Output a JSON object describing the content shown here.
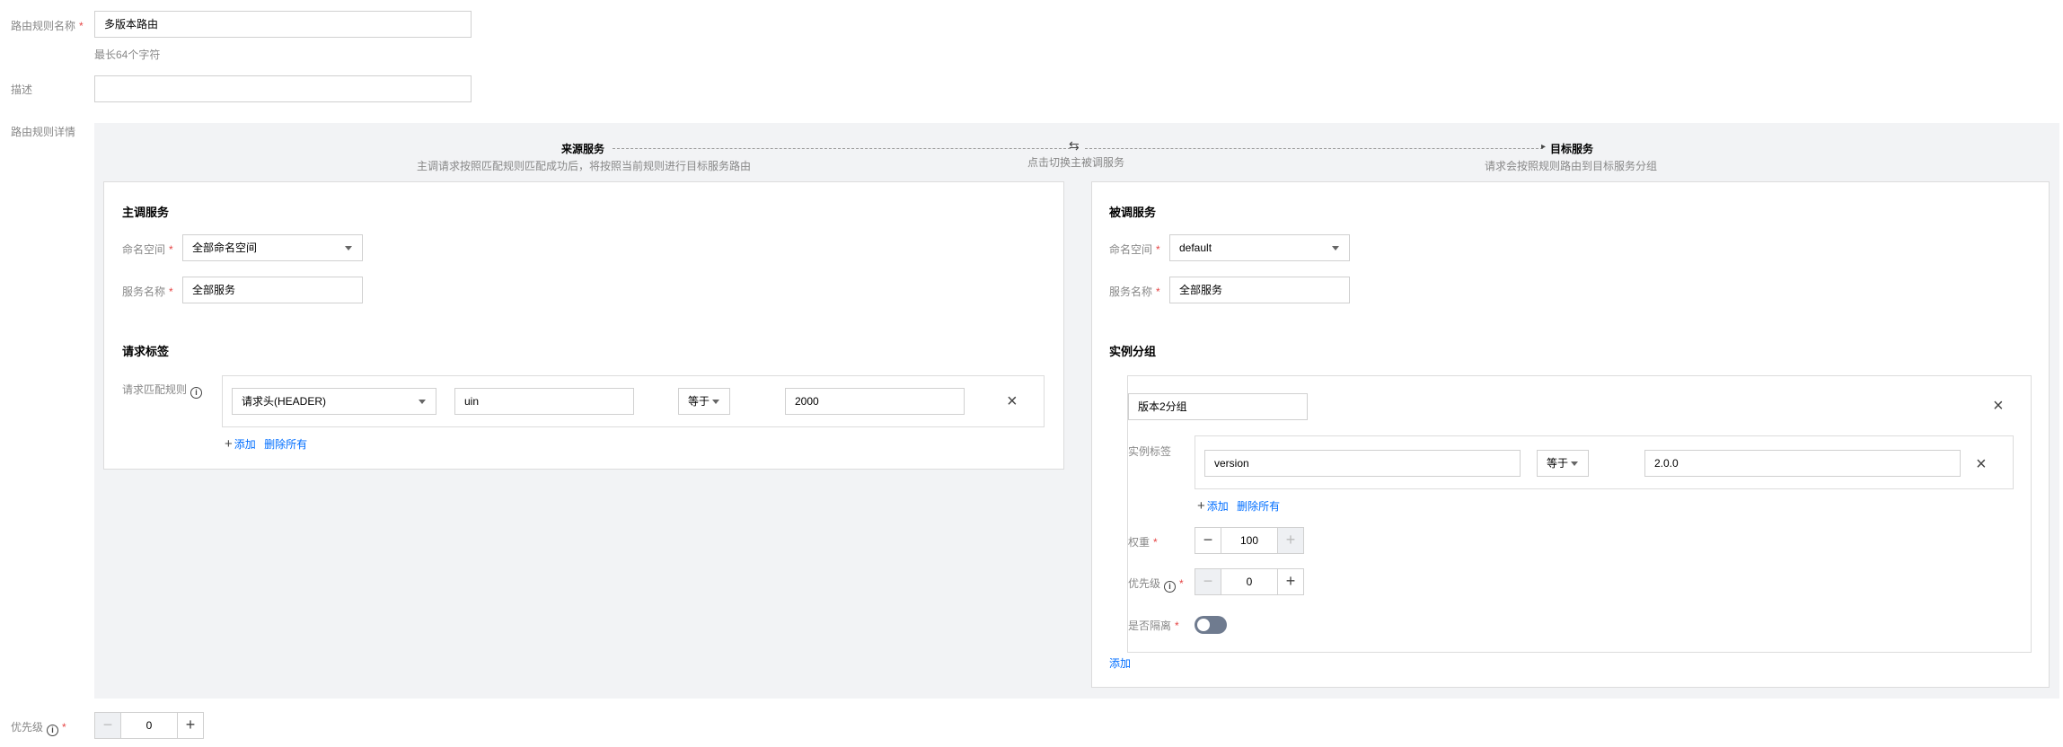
{
  "form": {
    "name_label": "路由规则名称",
    "required_mark": "*",
    "name_value": "多版本路由",
    "name_hint": "最长64个字符",
    "desc_label": "描述",
    "desc_value": "",
    "detail_label": "路由规则详情",
    "priority_label": "优先级",
    "priority_value": "0"
  },
  "flow": {
    "source_title": "来源服务",
    "source_desc": "主调请求按照匹配规则匹配成功后，将按照当前规则进行目标服务路由",
    "switch_symbol": "⇆",
    "switch_text": "点击切换主被调服务",
    "target_title": "目标服务",
    "target_desc": "请求会按照规则路由到目标服务分组",
    "arrow": "▸"
  },
  "caller": {
    "title": "主调服务",
    "namespace_label": "命名空间",
    "namespace_value": "全部命名空间",
    "service_label": "服务名称",
    "service_value": "全部服务",
    "tags_title": "请求标签",
    "match_label": "请求匹配规则",
    "rule": {
      "type": "请求头(HEADER)",
      "key": "uin",
      "op": "等于",
      "value": "2000"
    },
    "add": "添加",
    "delete_all": "删除所有"
  },
  "callee": {
    "title": "被调服务",
    "namespace_label": "命名空间",
    "namespace_value": "default",
    "service_label": "服务名称",
    "service_value": "全部服务",
    "group_title": "实例分组",
    "group": {
      "name": "版本2分组",
      "tag_label": "实例标签",
      "tag": {
        "key": "version",
        "op": "等于",
        "value": "2.0.0"
      },
      "add": "添加",
      "delete_all": "删除所有",
      "weight_label": "权重",
      "weight_value": "100",
      "priority_label": "优先级",
      "priority_value": "0",
      "isolate_label": "是否隔离",
      "isolated": false
    },
    "add_group": "添加"
  },
  "icons": {
    "close": "×",
    "plus": "+",
    "minus": "−",
    "info": "i"
  },
  "colors": {
    "link": "#006eff",
    "required": "#e54545",
    "detail_bg": "#f2f3f5",
    "toggle_off": "#6f7b8f"
  }
}
